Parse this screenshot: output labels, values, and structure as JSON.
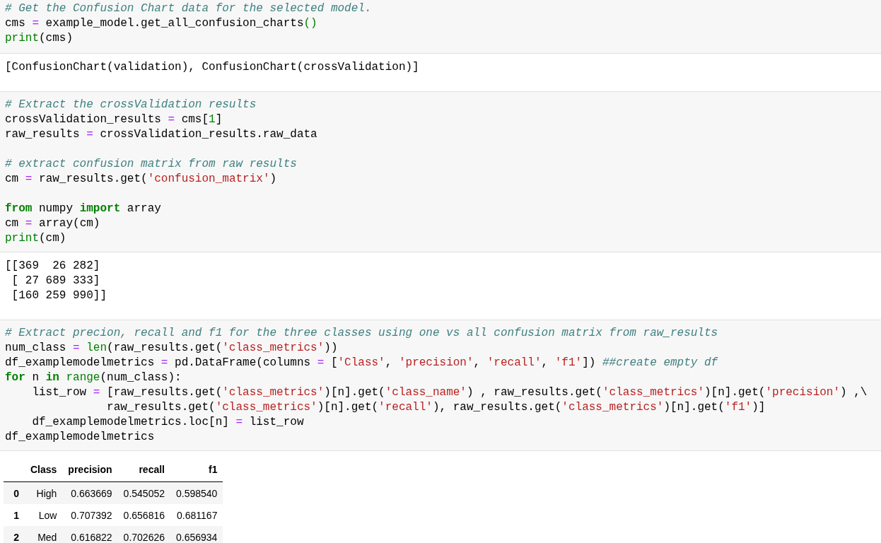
{
  "cells": [
    {
      "input": [
        [
          {
            "tokens": [
              {
                "kind": "comment",
                "text": "# Get the Confusion Chart data for the selected model."
              }
            ]
          },
          {
            "tokens": [
              {
                "kind": "plain",
                "text": "cms "
              },
              {
                "kind": "operator",
                "text": "="
              },
              {
                "kind": "plain",
                "text": " example_model.get_all_confusion_charts"
              },
              {
                "kind": "builtin",
                "text": "()"
              }
            ]
          },
          {
            "tokens": [
              {
                "kind": "builtin",
                "text": "print"
              },
              {
                "kind": "plain",
                "text": "(cms)"
              }
            ]
          }
        ]
      ],
      "output": {
        "kind": "text",
        "lines": [
          "[ConfusionChart(validation), ConfusionChart(crossValidation)]"
        ]
      }
    },
    {
      "input": [
        [
          {
            "tokens": [
              {
                "kind": "comment",
                "text": "# Extract the crossValidation results"
              }
            ]
          },
          {
            "tokens": [
              {
                "kind": "plain",
                "text": "crossValidation_results "
              },
              {
                "kind": "operator",
                "text": "="
              },
              {
                "kind": "plain",
                "text": " cms["
              },
              {
                "kind": "number",
                "text": "1"
              },
              {
                "kind": "plain",
                "text": "]"
              }
            ]
          },
          {
            "tokens": [
              {
                "kind": "plain",
                "text": "raw_results "
              },
              {
                "kind": "operator",
                "text": "="
              },
              {
                "kind": "plain",
                "text": " crossValidation_results.raw_data"
              }
            ]
          }
        ],
        [
          {
            "tokens": [
              {
                "kind": "comment",
                "text": "# extract confusion matrix from raw results"
              }
            ]
          },
          {
            "tokens": [
              {
                "kind": "plain",
                "text": "cm "
              },
              {
                "kind": "operator",
                "text": "="
              },
              {
                "kind": "plain",
                "text": " raw_results.get("
              },
              {
                "kind": "string",
                "text": "'confusion_matrix'"
              },
              {
                "kind": "plain",
                "text": ")"
              }
            ]
          }
        ],
        [
          {
            "tokens": [
              {
                "kind": "keyword",
                "text": "from"
              },
              {
                "kind": "plain",
                "text": " numpy "
              },
              {
                "kind": "keyword",
                "text": "import"
              },
              {
                "kind": "plain",
                "text": " array"
              }
            ]
          },
          {
            "tokens": [
              {
                "kind": "plain",
                "text": "cm "
              },
              {
                "kind": "operator",
                "text": "="
              },
              {
                "kind": "plain",
                "text": " array(cm)"
              }
            ]
          },
          {
            "tokens": [
              {
                "kind": "builtin",
                "text": "print"
              },
              {
                "kind": "plain",
                "text": "(cm)"
              }
            ]
          }
        ]
      ],
      "output": {
        "kind": "text",
        "lines": [
          "[[369  26 282]",
          " [ 27 689 333]",
          " [160 259 990]]"
        ]
      }
    },
    {
      "input": [
        [
          {
            "tokens": [
              {
                "kind": "comment",
                "text": "# Extract precion, recall and f1 for the three classes using one vs all confusion matrix from raw_results"
              }
            ]
          },
          {
            "tokens": [
              {
                "kind": "plain",
                "text": "num_class "
              },
              {
                "kind": "operator",
                "text": "= "
              },
              {
                "kind": "builtin",
                "text": "len"
              },
              {
                "kind": "plain",
                "text": "(raw_results.get("
              },
              {
                "kind": "string",
                "text": "'class_metrics'"
              },
              {
                "kind": "plain",
                "text": "))"
              }
            ]
          },
          {
            "tokens": [
              {
                "kind": "plain",
                "text": "df_examplemodelmetrics "
              },
              {
                "kind": "operator",
                "text": "="
              },
              {
                "kind": "plain",
                "text": " pd.DataFrame(columns "
              },
              {
                "kind": "operator",
                "text": "="
              },
              {
                "kind": "plain",
                "text": " ["
              },
              {
                "kind": "string",
                "text": "'Class'"
              },
              {
                "kind": "plain",
                "text": ", "
              },
              {
                "kind": "string",
                "text": "'precision'"
              },
              {
                "kind": "plain",
                "text": ", "
              },
              {
                "kind": "string",
                "text": "'recall'"
              },
              {
                "kind": "plain",
                "text": ", "
              },
              {
                "kind": "string",
                "text": "'f1'"
              },
              {
                "kind": "plain",
                "text": "]) "
              },
              {
                "kind": "comment",
                "text": "##create empty df"
              }
            ]
          },
          {
            "tokens": [
              {
                "kind": "keyword",
                "text": "for"
              },
              {
                "kind": "plain",
                "text": " n "
              },
              {
                "kind": "keyword",
                "text": "in "
              },
              {
                "kind": "builtin",
                "text": "range"
              },
              {
                "kind": "plain",
                "text": "(num_class):"
              }
            ]
          },
          {
            "tokens": [
              {
                "kind": "plain",
                "text": "    list_row "
              },
              {
                "kind": "operator",
                "text": "="
              },
              {
                "kind": "plain",
                "text": " [raw_results.get("
              },
              {
                "kind": "string",
                "text": "'class_metrics'"
              },
              {
                "kind": "plain",
                "text": ")[n].get("
              },
              {
                "kind": "string",
                "text": "'class_name'"
              },
              {
                "kind": "plain",
                "text": ") , raw_results.get("
              },
              {
                "kind": "string",
                "text": "'class_metrics'"
              },
              {
                "kind": "plain",
                "text": ")[n].get("
              },
              {
                "kind": "string",
                "text": "'precision'"
              },
              {
                "kind": "plain",
                "text": ") ,\\"
              }
            ]
          },
          {
            "tokens": [
              {
                "kind": "plain",
                "text": "               raw_results.get("
              },
              {
                "kind": "string",
                "text": "'class_metrics'"
              },
              {
                "kind": "plain",
                "text": ")[n].get("
              },
              {
                "kind": "string",
                "text": "'recall'"
              },
              {
                "kind": "plain",
                "text": "), raw_results.get("
              },
              {
                "kind": "string",
                "text": "'class_metrics'"
              },
              {
                "kind": "plain",
                "text": ")[n].get("
              },
              {
                "kind": "string",
                "text": "'f1'"
              },
              {
                "kind": "plain",
                "text": ")]"
              }
            ]
          },
          {
            "tokens": [
              {
                "kind": "plain",
                "text": "    df_examplemodelmetrics.loc[n] "
              },
              {
                "kind": "operator",
                "text": "="
              },
              {
                "kind": "plain",
                "text": " list_row"
              }
            ]
          },
          {
            "tokens": [
              {
                "kind": "plain",
                "text": "df_examplemodelmetrics"
              }
            ]
          }
        ]
      ],
      "output": {
        "kind": "table",
        "columns": [
          "Class",
          "precision",
          "recall",
          "f1"
        ],
        "rows": [
          {
            "index": "0",
            "cells": [
              "High",
              "0.663669",
              "0.545052",
              "0.598540"
            ]
          },
          {
            "index": "1",
            "cells": [
              "Low",
              "0.707392",
              "0.656816",
              "0.681167"
            ]
          },
          {
            "index": "2",
            "cells": [
              "Med",
              "0.616822",
              "0.702626",
              "0.656934"
            ]
          }
        ]
      }
    }
  ]
}
